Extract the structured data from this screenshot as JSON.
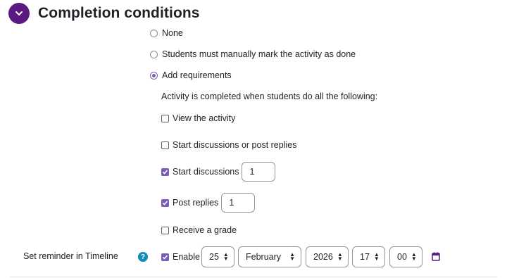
{
  "section": {
    "title": "Completion conditions"
  },
  "options": {
    "none": "None",
    "manual": "Students must manually mark the activity as done",
    "requirements": "Add requirements"
  },
  "requirements": {
    "intro": "Activity is completed when students do all the following:",
    "view": "View the activity",
    "start_or_post": "Start discussions or post replies",
    "start": "Start discussions",
    "start_count": "1",
    "post": "Post replies",
    "post_count": "1",
    "grade": "Receive a grade"
  },
  "reminder": {
    "label": "Set reminder in Timeline",
    "enable": "Enable",
    "day": "25",
    "month": "February",
    "year": "2026",
    "hour": "17",
    "minute": "00"
  },
  "colors": {
    "accent": "#5b1a80",
    "check": "#7a5fb0",
    "help": "#0f8cb4"
  },
  "icons": {
    "collapse": "chevron-down-icon",
    "help": "question-icon",
    "calendar": "calendar-icon"
  }
}
